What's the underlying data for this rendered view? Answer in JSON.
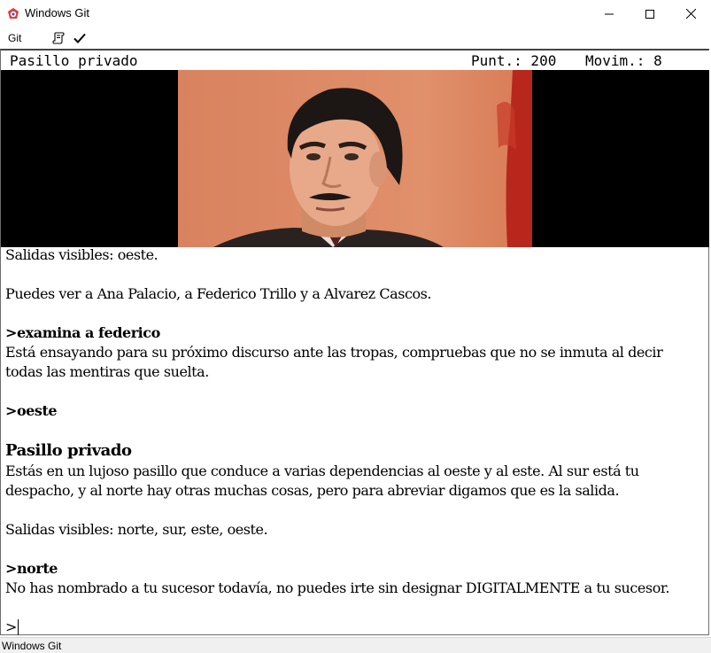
{
  "window": {
    "title": "Windows Git",
    "minimize_icon": "minimize-icon",
    "maximize_icon": "maximize-icon",
    "close_icon": "close-icon"
  },
  "menu": {
    "git_label": "Git",
    "toolbar_icons": [
      "script-icon",
      "checkmark-icon"
    ]
  },
  "status_line": {
    "room": "Pasillo privado",
    "score": "Punt.: 200",
    "moves": "Movim.: 8"
  },
  "image": {
    "description_icon": "portrait-photo",
    "background": "#000000"
  },
  "transcript": {
    "exits_partial": "Salidas visibles: oeste.",
    "people": "Puedes ver a Ana Palacio, a Federico Trillo y a Alvarez Cascos.",
    "cmd_examine": ">examina a federico",
    "examine_response_1": "Está ensayando para su próximo discurso ante las tropas, compruebas que no se inmuta al decir",
    "examine_response_2": "todas las mentiras que suelta.",
    "cmd_west": ">oeste",
    "room_title": "Pasillo privado",
    "room_desc_1": "Estás en un lujoso pasillo que conduce a varias dependencias al oeste y al este. Al sur está tu",
    "room_desc_2": "despacho, y al norte hay otras muchas cosas, pero para abreviar digamos que es la salida.",
    "exits_full": "Salidas visibles: norte, sur, este, oeste.",
    "cmd_north": ">norte",
    "north_response": "No has nombrado a tu sucesor todavía, no puedes irte sin designar DIGITALMENTE a tu sucesor.",
    "prompt": ">"
  },
  "statusbar": {
    "text": "Windows Git"
  },
  "colors": {
    "frame": "#6d6d6d",
    "statusbar_bg": "#f0f0f0",
    "portrait_bg": "#d9825f"
  }
}
